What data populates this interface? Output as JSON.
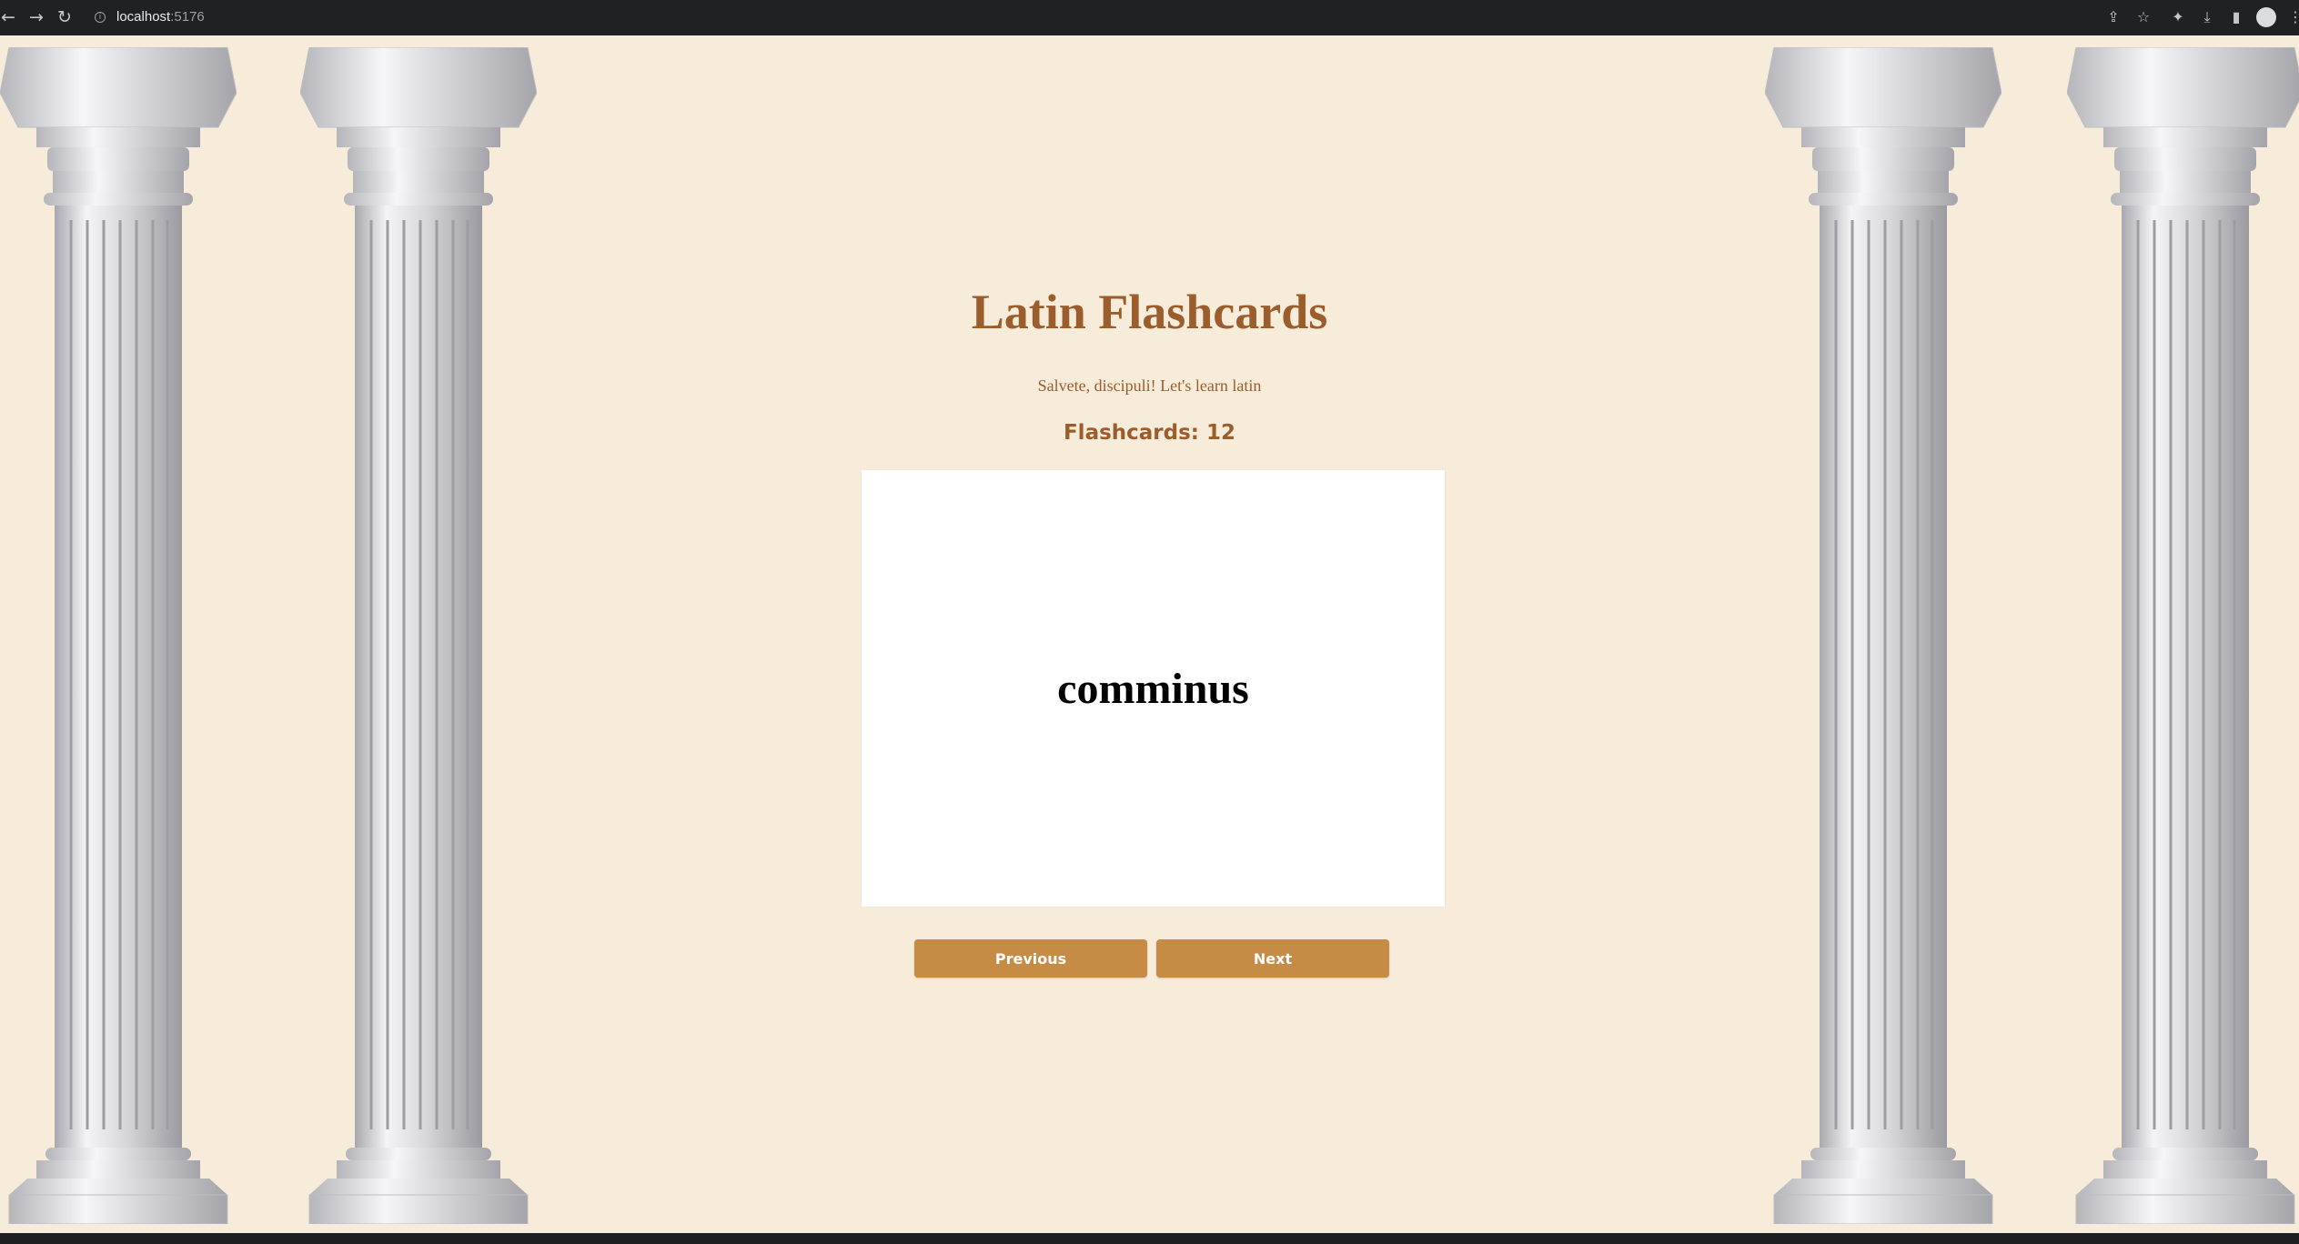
{
  "browser": {
    "url_host": "localhost",
    "url_port": ":5176",
    "icons": [
      "back-icon",
      "forward-icon",
      "reload-icon",
      "site-info-icon",
      "share-icon",
      "bookmark-star-icon",
      "extensions-icon",
      "download-icon",
      "side-panel-icon",
      "profile-avatar",
      "menu-icon"
    ]
  },
  "header": {
    "title": "Latin Flashcards",
    "subtitle": "Salvete, discipuli! Let's learn latin",
    "counter": "Flashcards: 12"
  },
  "card": {
    "word": "comminus"
  },
  "controls": {
    "previous_label": "Previous",
    "next_label": "Next"
  },
  "colors": {
    "background": "#f7ebda",
    "accent_text": "#9c5d2c",
    "button": "#c68c45",
    "card": "#ffffff"
  }
}
